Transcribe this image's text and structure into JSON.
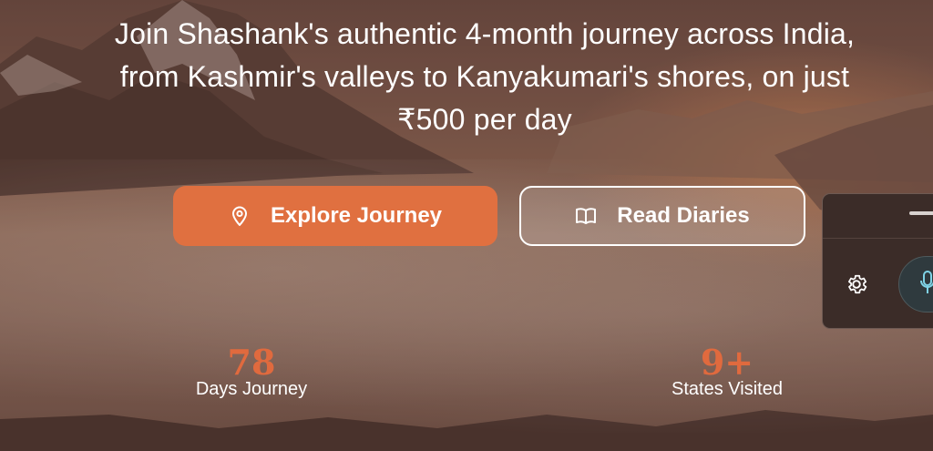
{
  "hero": {
    "subtitle_lines": [
      "Join Shashank's authentic 4-month journey across India,",
      "from Kashmir's valleys to Kanyakumari's shores, on just",
      "₹500 per day"
    ]
  },
  "buttons": {
    "explore": {
      "label": "Explore Journey",
      "icon": "location-pin-icon"
    },
    "read": {
      "label": "Read Diaries",
      "icon": "open-book-icon"
    }
  },
  "stats": [
    {
      "value": "78",
      "label": "Days Journey"
    },
    {
      "value": "9+",
      "label": "States Visited"
    }
  ],
  "widget": {
    "icons": [
      "settings-gear-icon",
      "microphone-icon"
    ]
  },
  "colors": {
    "accent": "#e07040",
    "stat_number": "#e06a3e",
    "text": "#ffffff"
  }
}
